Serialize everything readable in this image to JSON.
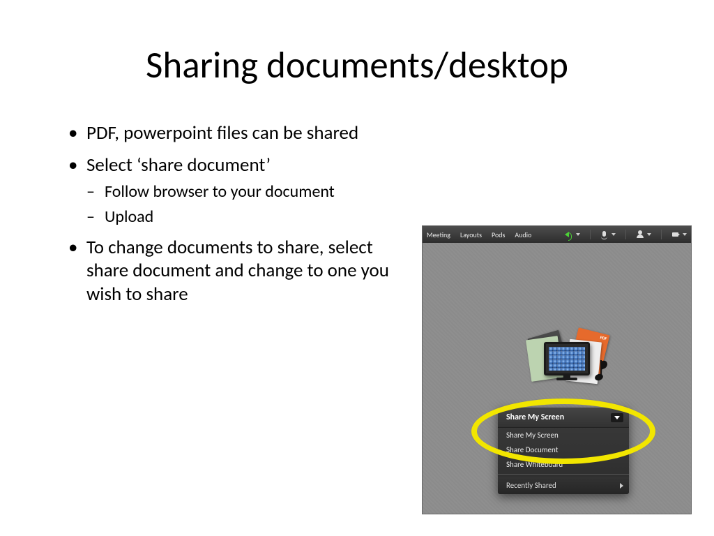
{
  "title": "Sharing documents/desktop",
  "bullets": [
    {
      "text": "PDF, powerpoint files can be shared"
    },
    {
      "text": "Select ‘share document’",
      "sub": [
        "Follow browser to your document",
        "Upload"
      ]
    },
    {
      "text": "To change documents to share, select share document and change to one you wish to share"
    }
  ],
  "app": {
    "menus": [
      "Meeting",
      "Layouts",
      "Pods",
      "Audio"
    ],
    "dropdown": {
      "header": "Share My Screen",
      "items": [
        "Share My Screen",
        "Share Document",
        "Share Whiteboard"
      ],
      "footer": "Recently Shared"
    }
  }
}
